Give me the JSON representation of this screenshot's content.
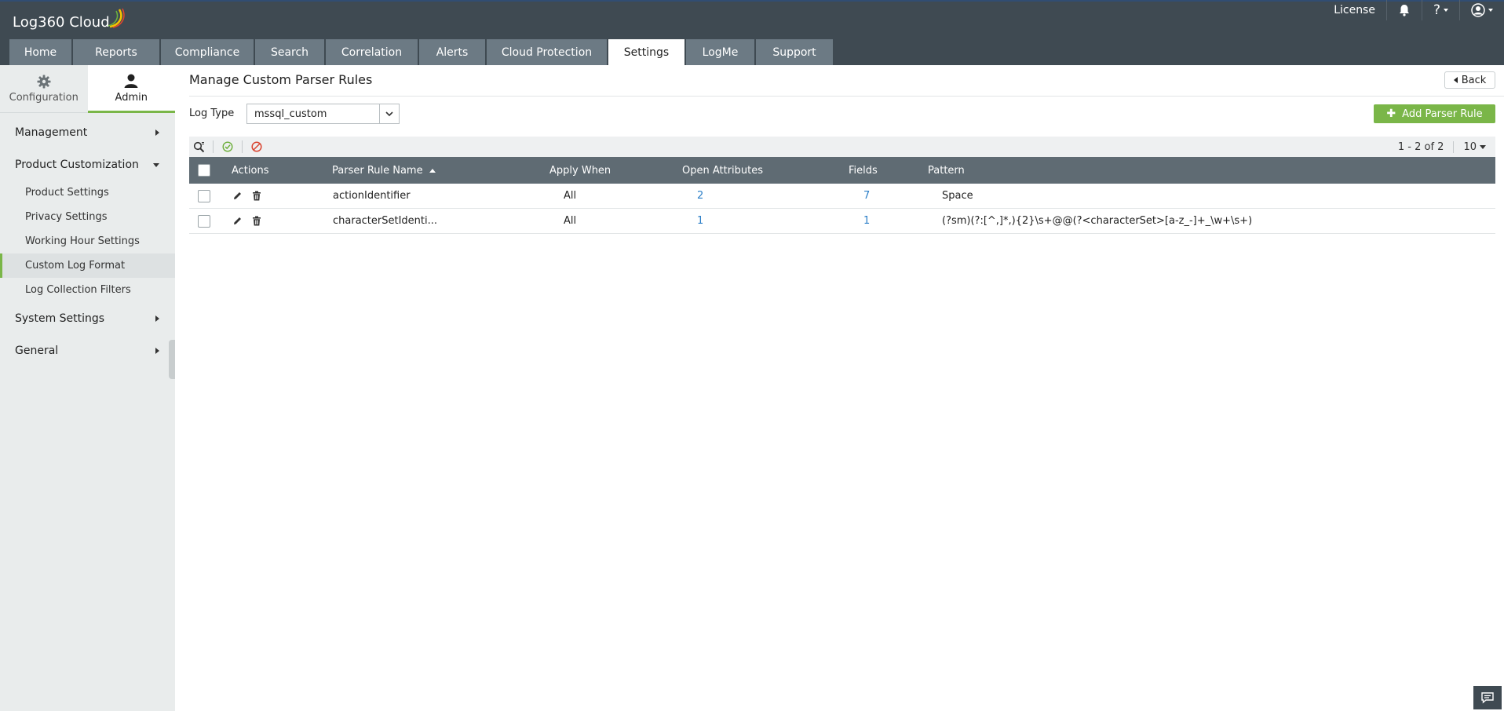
{
  "header": {
    "logo_text": "Log360 Cloud",
    "license_label": "License",
    "help_label": "?",
    "tabs": [
      {
        "label": "Home"
      },
      {
        "label": "Reports"
      },
      {
        "label": "Compliance"
      },
      {
        "label": "Search"
      },
      {
        "label": "Correlation"
      },
      {
        "label": "Alerts"
      },
      {
        "label": "Cloud Protection"
      },
      {
        "label": "Settings",
        "active": true
      },
      {
        "label": "LogMe"
      },
      {
        "label": "Support"
      }
    ]
  },
  "sidebar": {
    "tabs": [
      {
        "label": "Configuration",
        "icon": "gear-icon"
      },
      {
        "label": "Admin",
        "icon": "user-icon",
        "active": true
      }
    ],
    "groups": [
      {
        "label": "Management",
        "expanded": false
      },
      {
        "label": "Product Customization",
        "expanded": true,
        "items": [
          {
            "label": "Product Settings"
          },
          {
            "label": "Privacy Settings"
          },
          {
            "label": "Working Hour Settings"
          },
          {
            "label": "Custom Log Format",
            "active": true
          },
          {
            "label": "Log Collection Filters"
          }
        ]
      },
      {
        "label": "System Settings",
        "expanded": false
      },
      {
        "label": "General",
        "expanded": false
      }
    ]
  },
  "main": {
    "title": "Manage Custom Parser Rules",
    "back_label": "Back",
    "log_type_label": "Log Type",
    "log_type_value": "mssql_custom",
    "add_button_label": "Add Parser Rule",
    "pager": {
      "range": "1 - 2 of 2",
      "page_size": "10"
    },
    "columns": [
      "Actions",
      "Parser Rule Name",
      "Apply When",
      "Open Attributes",
      "Fields",
      "Pattern"
    ],
    "rows": [
      {
        "name": "actionIdentifier",
        "apply_when": "All",
        "open_attributes": "2",
        "fields": "7",
        "pattern": "Space"
      },
      {
        "name": "characterSetIdenti...",
        "apply_when": "All",
        "open_attributes": "1",
        "fields": "1",
        "pattern": "(?sm)(?:[^,]*,){2}\\s+@@(?<characterSet>[a-z_-]+_\\w+\\s+)"
      }
    ]
  },
  "colors": {
    "header_bg": "#3f4a52",
    "tab_bg": "#6c7a84",
    "accent_green": "#7ab648",
    "grid_header_bg": "#5f6b73",
    "link_blue": "#2a7ec7"
  }
}
